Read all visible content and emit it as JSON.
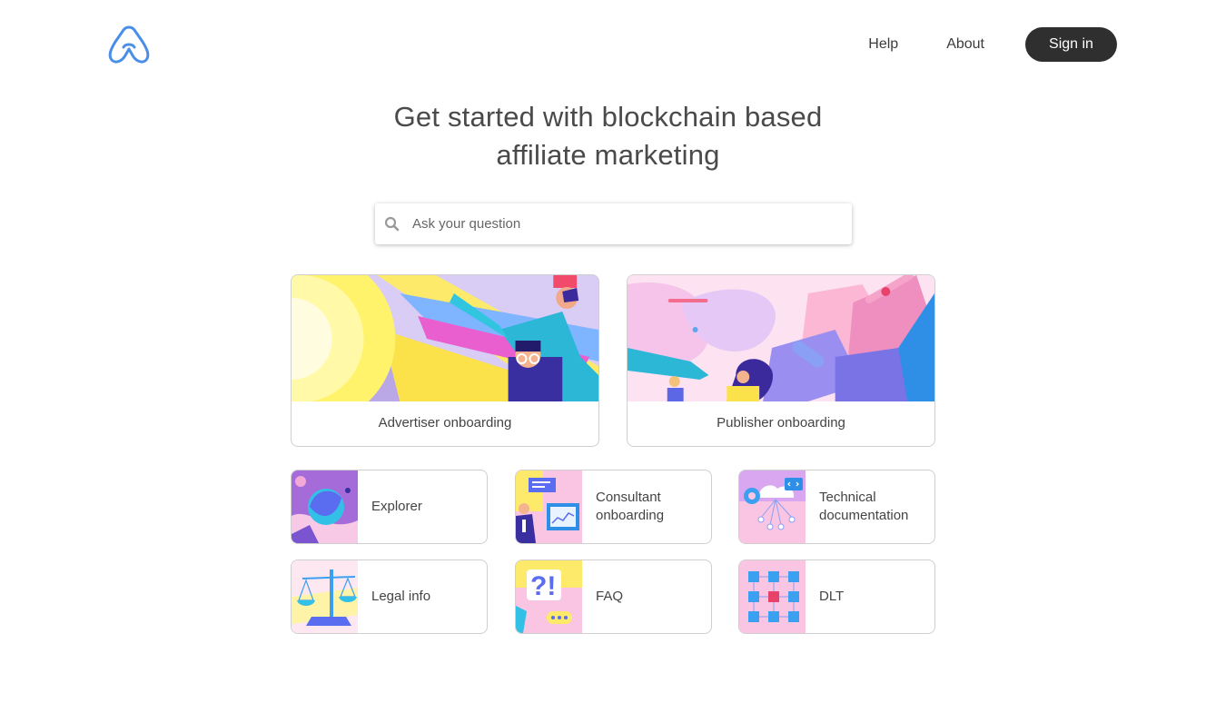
{
  "header": {
    "logo_icon": "brand-arch-logo-icon",
    "nav": {
      "help": "Help",
      "about": "About",
      "signin": "Sign in"
    }
  },
  "hero": {
    "title_line1": "Get started with blockchain based",
    "title_line2": "affiliate marketing"
  },
  "search": {
    "placeholder": "Ask your question",
    "icon": "search-icon"
  },
  "main_cards": [
    {
      "label": "Advertiser onboarding"
    },
    {
      "label": "Publisher onboarding"
    }
  ],
  "topic_cards": [
    {
      "label": "Explorer"
    },
    {
      "label_line1": "Consultant",
      "label_line2": "onboarding"
    },
    {
      "label_line1": "Technical",
      "label_line2": "documentation"
    },
    {
      "label": "Legal info"
    },
    {
      "label": "FAQ"
    },
    {
      "label": "DLT"
    }
  ],
  "colors": {
    "brand_blue": "#4a8fe7",
    "button_dark": "#2f2f2f",
    "text": "#4a4a4a"
  }
}
